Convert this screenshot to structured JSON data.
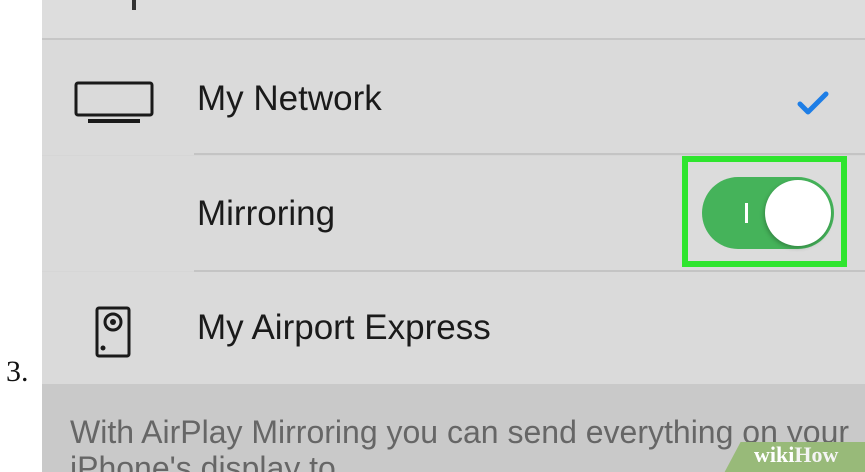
{
  "step": {
    "number": "3."
  },
  "settings": {
    "rows": [
      {
        "label": "My Network",
        "icon": "tv-icon",
        "selected": true
      },
      {
        "label": "Mirroring",
        "toggle_on": true
      },
      {
        "label": "My Airport Express",
        "icon": "speaker-icon"
      }
    ]
  },
  "footer": {
    "text": "With AirPlay Mirroring you can send everything on your iPhone's display to"
  },
  "watermark": {
    "wiki": "wiki",
    "how": "How"
  },
  "colors": {
    "background": "#d6d6d6",
    "checkmark": "#1e7ee6",
    "toggle_on": "#45b35a",
    "highlight": "#2ee52e",
    "watermark": "#98ba79"
  }
}
